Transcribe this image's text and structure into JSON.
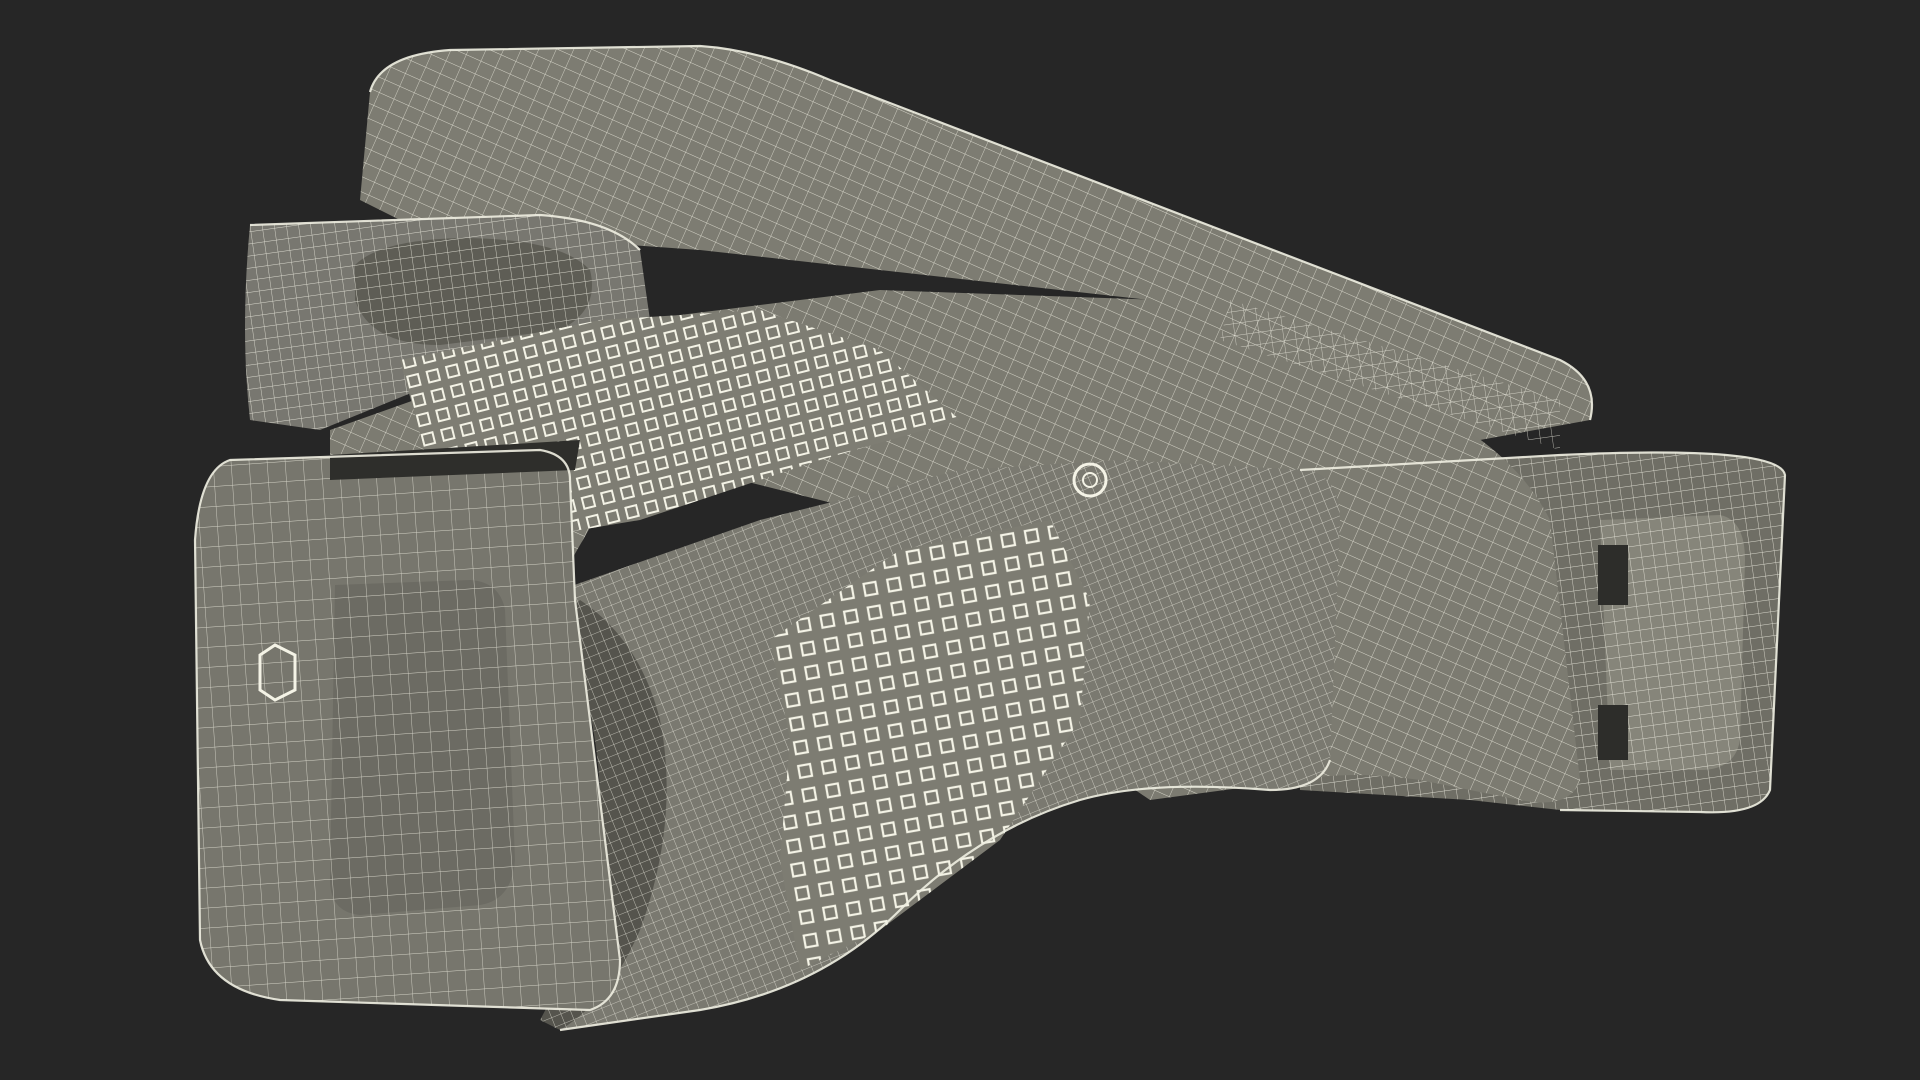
{
  "scene": {
    "background_color": "#262626",
    "surface_color": "#7b7a70",
    "surface_shadow_color": "#5f5e56",
    "surface_highlight_color": "#8e8d82",
    "wire_color": "#e8e8da",
    "object": "pistol-frame-wireframe-render"
  }
}
